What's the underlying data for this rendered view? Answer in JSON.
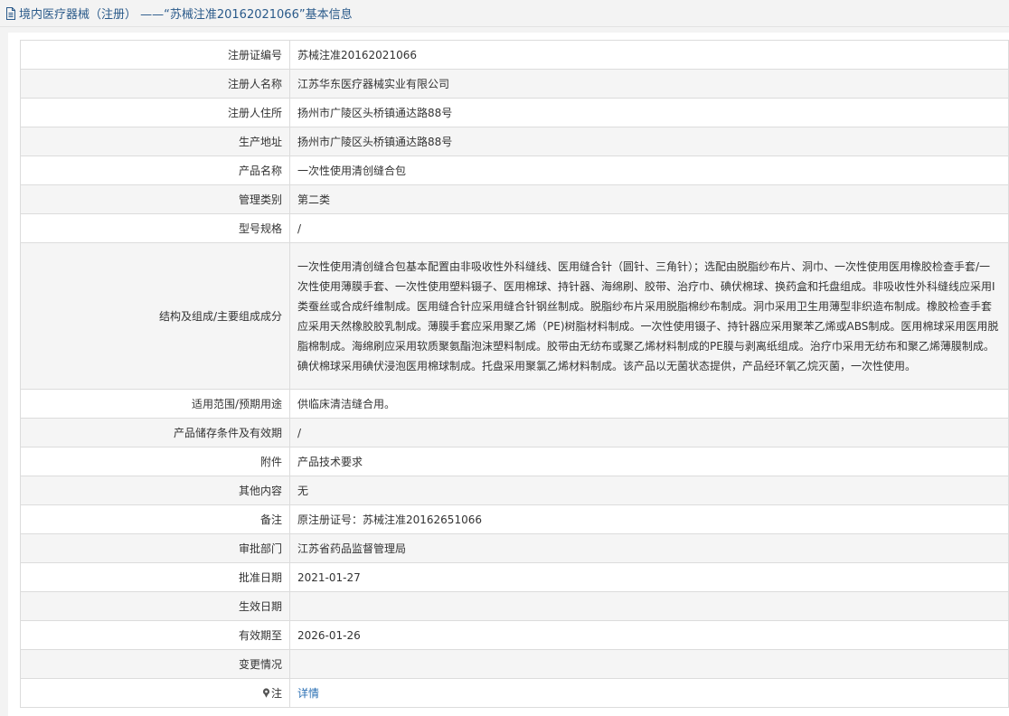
{
  "header": {
    "title": "境内医疗器械（注册） ——“苏械注准20162021066”基本信息"
  },
  "rows": [
    {
      "label": "注册证编号",
      "value": "苏械注准20162021066"
    },
    {
      "label": "注册人名称",
      "value": "江苏华东医疗器械实业有限公司"
    },
    {
      "label": "注册人住所",
      "value": "扬州市广陵区头桥镇通达路88号"
    },
    {
      "label": "生产地址",
      "value": "扬州市广陵区头桥镇通达路88号"
    },
    {
      "label": "产品名称",
      "value": "一次性使用清创缝合包"
    },
    {
      "label": "管理类别",
      "value": "第二类"
    },
    {
      "label": "型号规格",
      "value": "/"
    },
    {
      "label": "结构及组成/主要组成成分",
      "value": "一次性使用清创缝合包基本配置由非吸收性外科缝线、医用缝合针（圆针、三角针）；选配由脱脂纱布片、洞巾、一次性使用医用橡胶检查手套/一次性使用薄膜手套、一次性使用塑料镊子、医用棉球、持针器、海绵刷、胶带、治疗巾、碘伏棉球、换药盒和托盘组成。非吸收性外科缝线应采用Ⅰ类蚕丝或合成纤维制成。医用缝合针应采用缝合针钢丝制成。脱脂纱布片采用脱脂棉纱布制成。洞巾采用卫生用薄型非织造布制成。橡胶检查手套应采用天然橡胶胶乳制成。薄膜手套应采用聚乙烯（PE)树脂材料制成。一次性使用镊子、持针器应采用聚苯乙烯或ABS制成。医用棉球采用医用脱脂棉制成。海绵刷应采用软质聚氨酯泡沫塑料制成。胶带由无纺布或聚乙烯材料制成的PE膜与剥离纸组成。治疗巾采用无纺布和聚乙烯薄膜制成。碘伏棉球采用碘伏浸泡医用棉球制成。托盘采用聚氯乙烯材料制成。该产品以无菌状态提供，产品经环氧乙烷灭菌，一次性使用。"
    },
    {
      "label": "适用范围/预期用途",
      "value": "供临床清洁缝合用。"
    },
    {
      "label": "产品储存条件及有效期",
      "value": "/"
    },
    {
      "label": "附件",
      "value": "产品技术要求"
    },
    {
      "label": "其他内容",
      "value": "无"
    },
    {
      "label": "备注",
      "value": "原注册证号：苏械注准20162651066"
    },
    {
      "label": "审批部门",
      "value": "江苏省药品监督管理局"
    },
    {
      "label": "批准日期",
      "value": "2021-01-27"
    },
    {
      "label": "生效日期",
      "value": ""
    },
    {
      "label": "有效期至",
      "value": "2026-01-26"
    },
    {
      "label": "变更情况",
      "value": ""
    }
  ],
  "note": {
    "label": "注",
    "link_text": "详情"
  },
  "colors": {
    "title": "#2a5a8a",
    "link": "#2a6fb3",
    "border": "#dcdcdc",
    "row_alt": "#f5f5f5"
  }
}
